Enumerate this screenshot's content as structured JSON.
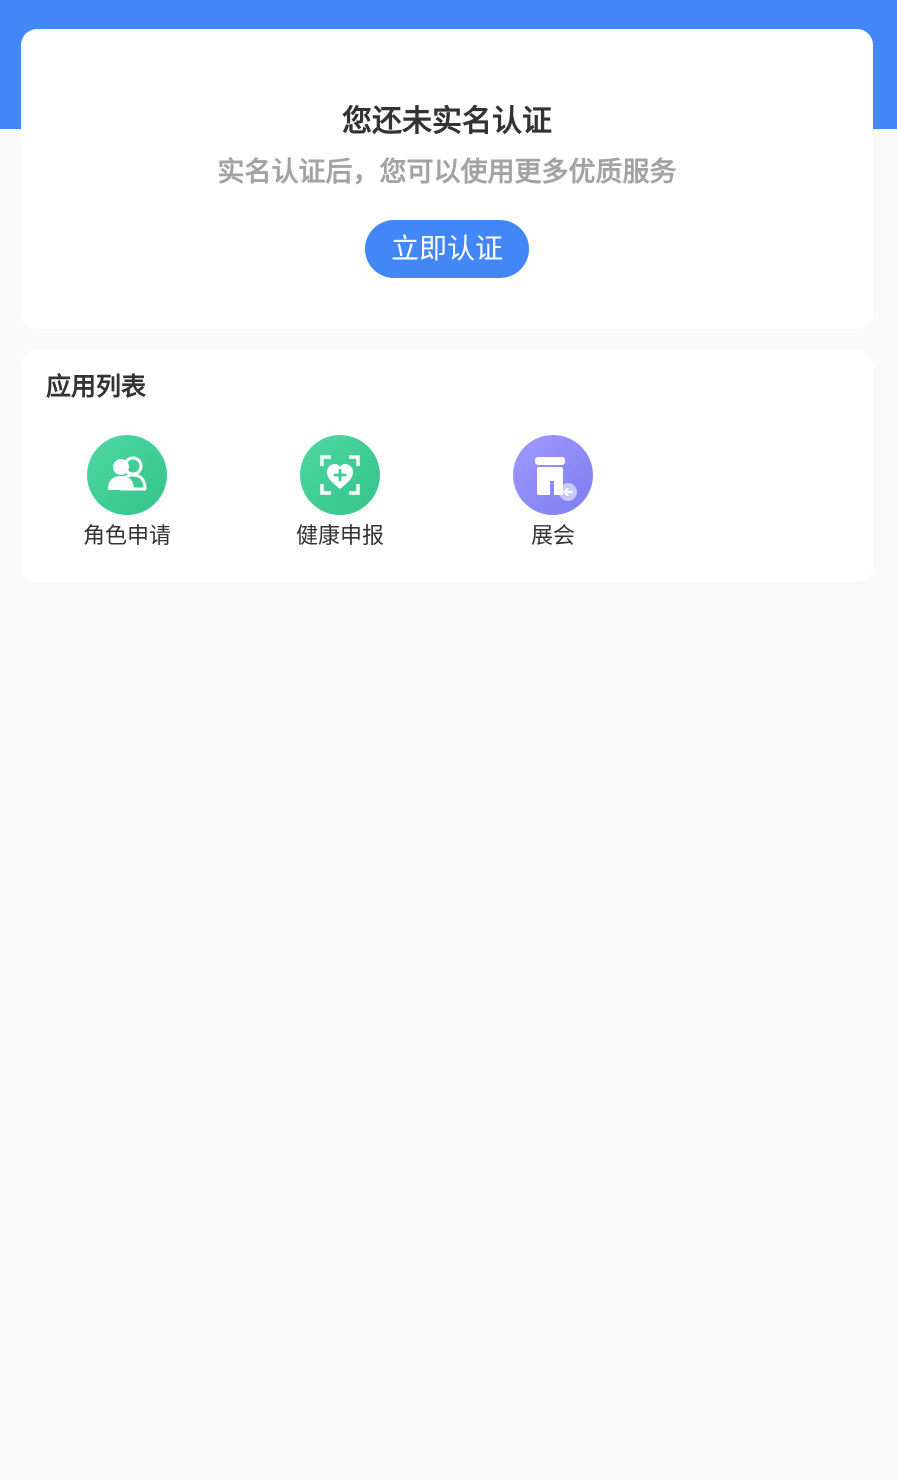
{
  "verify_card": {
    "title": "您还未实名认证",
    "subtitle": "实名认证后，您可以使用更多优质服务",
    "button_label": "立即认证"
  },
  "apps": {
    "title": "应用列表",
    "items": [
      {
        "label": "角色申请",
        "icon": "people-icon"
      },
      {
        "label": "健康申报",
        "icon": "health-scan-icon"
      },
      {
        "label": "展会",
        "icon": "exhibition-store-icon"
      }
    ]
  },
  "colors": {
    "primary": "#4287f5",
    "green_icon": "#3ccf93",
    "purple_icon": "#8f8cf7",
    "subtitle_gray": "#a3a3a3"
  }
}
